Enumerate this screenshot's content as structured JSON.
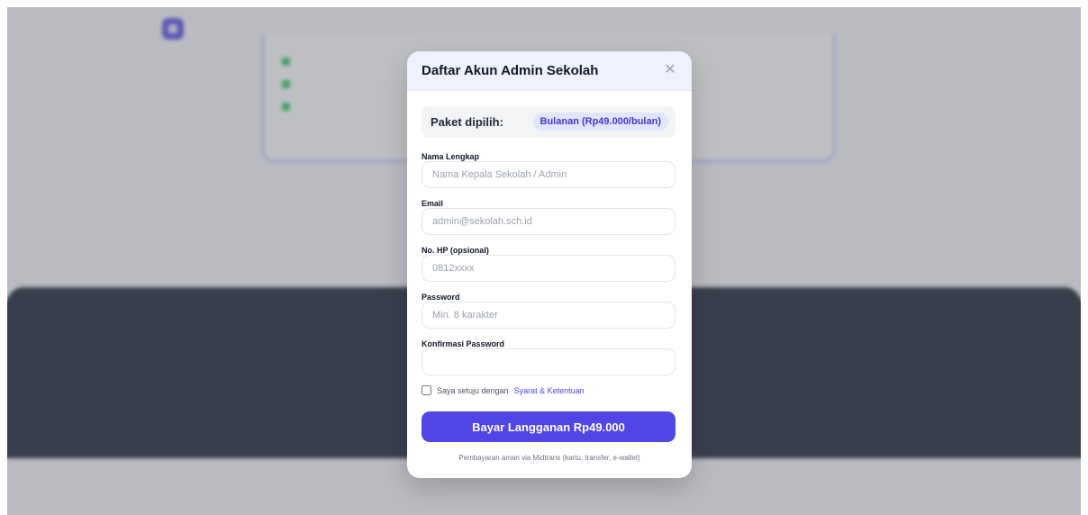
{
  "modal": {
    "title": "Daftar Akun Admin Sekolah",
    "close_icon": "close-icon",
    "plan_label": "Paket dipilih:",
    "plan_badge": "Bulanan (Rp49.000/bulan)",
    "fields": [
      {
        "label": "Nama Lengkap",
        "placeholder": "Nama Kepala Sekolah / Admin",
        "value": ""
      },
      {
        "label": "Email",
        "placeholder": "admin@sekolah.sch.id",
        "value": ""
      },
      {
        "label": "No. HP (opsional)",
        "placeholder": "0812xxxx",
        "value": ""
      },
      {
        "label": "Password",
        "placeholder": "Min. 8 karakter",
        "value": ""
      },
      {
        "label": "Konfirmasi Password",
        "placeholder": "",
        "value": ""
      }
    ],
    "agree_text": "Saya setuju dengan",
    "agree_link": "Syarat & Ketentuan",
    "pay_button": "Bayar Langganan  Rp49.000",
    "pay_note": "Pembayaran aman via Midtrans (kartu, transfer, e-wallet)"
  },
  "colors": {
    "accent": "#4f46e5",
    "header_bg": "#eef2ff",
    "dark_section": "#0f172a",
    "check_green": "#22c55e"
  }
}
